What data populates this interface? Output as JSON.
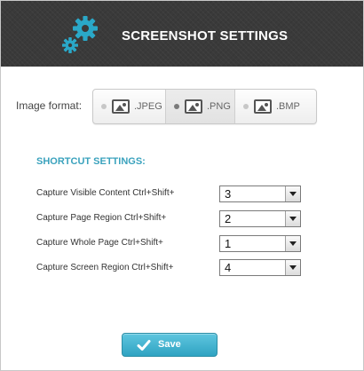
{
  "header": {
    "title": "SCREENSHOT SETTINGS",
    "icon": "gears-icon",
    "accent_color": "#2aa8c8"
  },
  "image_format": {
    "label": "Image format:",
    "options": [
      {
        "label": ".JPEG",
        "icon": "image-icon",
        "selected": false
      },
      {
        "label": ".PNG",
        "icon": "image-icon",
        "selected": true
      },
      {
        "label": ".BMP",
        "icon": "image-icon",
        "selected": false
      }
    ]
  },
  "shortcuts": {
    "title": "SHORTCUT SETTINGS:",
    "rows": [
      {
        "label": "Capture Visible Content Ctrl+Shift+",
        "value": "3"
      },
      {
        "label": "Capture Page Region Ctrl+Shift+",
        "value": "2"
      },
      {
        "label": "Capture Whole Page Ctrl+Shift+",
        "value": "1"
      },
      {
        "label": "Capture Screen Region Ctrl+Shift+",
        "value": "4"
      }
    ]
  },
  "save_button": {
    "label": "Save",
    "icon": "checkmark-icon",
    "color": "#3db0cf"
  }
}
